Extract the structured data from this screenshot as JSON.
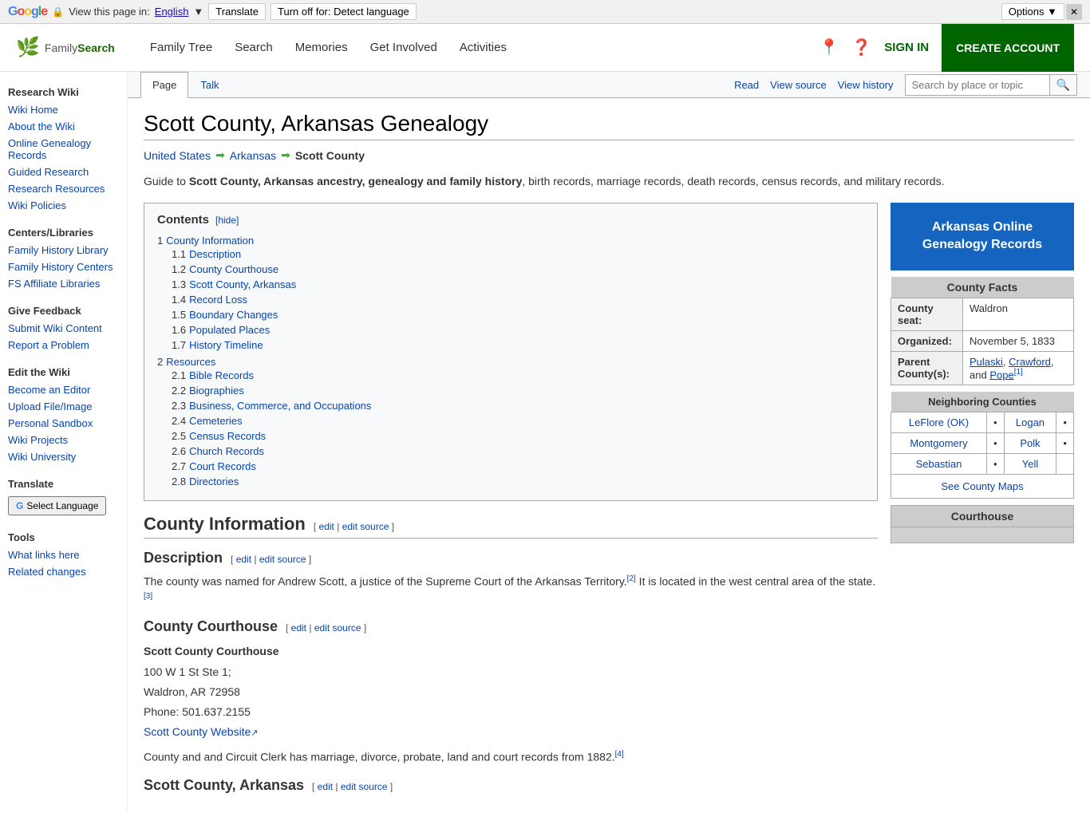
{
  "translate_bar": {
    "google_label": "Google",
    "view_text": "View this page in:",
    "language": "English",
    "translate_btn": "Translate",
    "turn_off_btn": "Turn off for: Detect language",
    "options_btn": "Options ▼",
    "close_btn": "✕"
  },
  "header": {
    "logo_text": "FamilySearch",
    "nav": [
      {
        "label": "Family Tree"
      },
      {
        "label": "Search"
      },
      {
        "label": "Memories"
      },
      {
        "label": "Get Involved"
      },
      {
        "label": "Activities"
      }
    ],
    "sign_in": "SIGN IN",
    "create_account": "CREATE ACCOUNT"
  },
  "sidebar": {
    "research_wiki": "Research Wiki",
    "items_research": [
      {
        "label": "Wiki Home"
      },
      {
        "label": "About the Wiki"
      },
      {
        "label": "Online Genealogy Records"
      },
      {
        "label": "Guided Research"
      },
      {
        "label": "Research Resources"
      },
      {
        "label": "Wiki Policies"
      }
    ],
    "centers_libraries": "Centers/Libraries",
    "items_centers": [
      {
        "label": "Family History Library"
      },
      {
        "label": "Family History Centers"
      },
      {
        "label": "FS Affiliate Libraries"
      }
    ],
    "give_feedback": "Give Feedback",
    "items_feedback": [
      {
        "label": "Submit Wiki Content"
      },
      {
        "label": "Report a Problem"
      }
    ],
    "edit_wiki": "Edit the Wiki",
    "items_edit": [
      {
        "label": "Become an Editor"
      },
      {
        "label": "Upload File/Image"
      },
      {
        "label": "Personal Sandbox"
      },
      {
        "label": "Wiki Projects"
      },
      {
        "label": "Wiki University"
      }
    ],
    "translate": "Translate",
    "select_language": "Select Language",
    "tools": "Tools",
    "items_tools": [
      {
        "label": "What links here"
      },
      {
        "label": "Related changes"
      }
    ]
  },
  "page_tabs": {
    "tabs": [
      {
        "label": "Page",
        "active": true
      },
      {
        "label": "Talk",
        "active": false
      }
    ],
    "actions": [
      {
        "label": "Read"
      },
      {
        "label": "View source"
      },
      {
        "label": "View history"
      }
    ],
    "search_placeholder": "Search by place or topic"
  },
  "page": {
    "title": "Scott County, Arkansas Genealogy",
    "breadcrumb": [
      {
        "label": "United States",
        "link": true
      },
      {
        "label": "Arkansas",
        "link": true
      },
      {
        "label": "Scott County",
        "link": false
      }
    ],
    "intro": "Guide to ",
    "intro_bold": "Scott County, Arkansas ancestry, genealogy and family history",
    "intro_rest": ", birth records, marriage records, death records, census records, and military records.",
    "toc": {
      "title": "Contents",
      "hide_label": "[hide]",
      "items": [
        {
          "num": "1",
          "label": "County Information",
          "sub": [
            {
              "num": "1.1",
              "label": "Description"
            },
            {
              "num": "1.2",
              "label": "County Courthouse"
            },
            {
              "num": "1.3",
              "label": "Scott County, Arkansas"
            },
            {
              "num": "1.4",
              "label": "Record Loss"
            },
            {
              "num": "1.5",
              "label": "Boundary Changes"
            },
            {
              "num": "1.6",
              "label": "Populated Places"
            },
            {
              "num": "1.7",
              "label": "History Timeline"
            }
          ]
        },
        {
          "num": "2",
          "label": "Resources",
          "sub": [
            {
              "num": "2.1",
              "label": "Bible Records"
            },
            {
              "num": "2.2",
              "label": "Biographies"
            },
            {
              "num": "2.3",
              "label": "Business, Commerce, and Occupations"
            },
            {
              "num": "2.4",
              "label": "Cemeteries"
            },
            {
              "num": "2.5",
              "label": "Census Records"
            },
            {
              "num": "2.6",
              "label": "Church Records"
            },
            {
              "num": "2.7",
              "label": "Court Records"
            },
            {
              "num": "2.8",
              "label": "Directories"
            }
          ]
        }
      ]
    },
    "county_info": {
      "header": "County Information",
      "edit1": "edit",
      "edit2": "edit source",
      "description_header": "Description",
      "description_edit1": "edit",
      "description_edit2": "edit source",
      "description_text": "The county was named for Andrew Scott, a justice of the Supreme Court of the Arkansas Territory.",
      "description_note1": "[2]",
      "description_text2": " It is located in the west central area of the state.",
      "description_note2": "[3]",
      "courthouse_header": "County Courthouse",
      "courthouse_edit1": "edit",
      "courthouse_edit2": "edit source",
      "courthouse_name": "Scott County Courthouse",
      "courthouse_address": "100 W 1 St Ste 1;",
      "courthouse_city": "Waldron, AR 72958",
      "courthouse_phone": "Phone: 501.637.2155",
      "courthouse_link": "Scott County Website",
      "courthouse_desc": "County and and Circuit Clerk has marriage, divorce, probate, land and court records from 1882.",
      "courthouse_note": "[4]",
      "scott_county_header": "Scott County, Arkansas",
      "scott_county_edit1": "edit",
      "scott_county_edit2": "edit source"
    },
    "right_panel": {
      "arkansas_btn": "Arkansas Online\nGenealogy Records",
      "county_facts_title": "County Facts",
      "county_seat_label": "County seat:",
      "county_seat_value": "Waldron",
      "organized_label": "Organized:",
      "organized_value": "November 5, 1833",
      "parent_label": "Parent County(s):",
      "parent_value": "Pulaski, Crawford, and Pope",
      "parent_note": "[1]",
      "neighboring_title": "Neighboring Counties",
      "neighboring_counties": [
        {
          "label": "LeFlore (OK)",
          "link": true
        },
        {
          "label": "•"
        },
        {
          "label": "Logan",
          "link": true
        },
        {
          "label": "•"
        }
      ],
      "neighboring_row2": [
        {
          "label": "Montgomery",
          "link": true
        },
        {
          "label": "•"
        },
        {
          "label": "Polk",
          "link": true
        },
        {
          "label": "•"
        }
      ],
      "neighboring_row3": [
        {
          "label": "Sebastian",
          "link": true
        },
        {
          "label": "•"
        },
        {
          "label": "Yell",
          "link": true
        }
      ],
      "see_maps": "See County Maps",
      "courthouse_title": "Courthouse"
    }
  }
}
